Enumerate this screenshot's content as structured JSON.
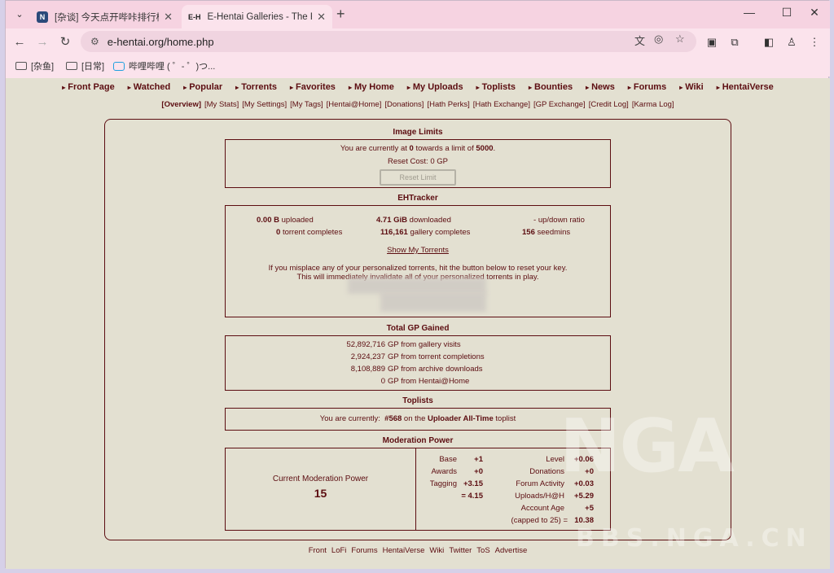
{
  "browser": {
    "tabs": [
      {
        "title": "[杂谈] 今天点开哔咔排行榜一",
        "active": false
      },
      {
        "title": "E-Hentai Galleries - The Free",
        "active": true
      }
    ],
    "inactive_favicon": "N",
    "active_favicon": "E-H",
    "url": "e-hentai.org/home.php",
    "bookmarks": [
      "[杂鱼]",
      "[日常]",
      "哔哩哔哩 ( ゜- ゜)つ..."
    ]
  },
  "nav": {
    "main": [
      "Front Page",
      "Watched",
      "Popular",
      "Torrents",
      "Favorites",
      "My Home",
      "My Uploads",
      "Toplists",
      "Bounties",
      "News",
      "Forums",
      "Wiki",
      "HentaiVerse"
    ],
    "sub": [
      "[Overview]",
      "[My Stats]",
      "[My Settings]",
      "[My Tags]",
      "[Hentai@Home]",
      "[Donations]",
      "[Hath Perks]",
      "[Hath Exchange]",
      "[GP Exchange]",
      "[Credit Log]",
      "[Karma Log]"
    ]
  },
  "image_limits": {
    "title": "Image Limits",
    "text_pre": "You are currently at ",
    "current": "0",
    "text_mid": " towards a limit of ",
    "limit": "5000",
    "text_post": ".",
    "reset_cost_label": "Reset Cost: ",
    "reset_cost_value": "0 GP",
    "reset_button": "Reset Limit"
  },
  "ehtracker": {
    "title": "EHTracker",
    "uploaded_value": "0.00 B",
    "uploaded_label": "uploaded",
    "downloaded_value": "4.71 GiB",
    "downloaded_label": "downloaded",
    "ratio_value": "-",
    "ratio_label": "up/down ratio",
    "torrent_completes_value": "0",
    "torrent_completes_label": "torrent completes",
    "gallery_completes_value": "116,161",
    "gallery_completes_label": "gallery completes",
    "seedmins_value": "156",
    "seedmins_label": "seedmins",
    "show_torrents": "Show My Torrents",
    "info_line1": "If you misplace any of your personalized torrents, hit the button below to reset your key.",
    "info_line2": "This will immediately invalidate all of your personalized torrents in play."
  },
  "gp_gained": {
    "title": "Total GP Gained",
    "rows": [
      {
        "value": "52,892,716",
        "label": "GP from gallery visits"
      },
      {
        "value": "2,924,237",
        "label": "GP from torrent completions"
      },
      {
        "value": "8,108,889",
        "label": "GP from archive downloads"
      },
      {
        "value": "0",
        "label": "GP from Hentai@Home"
      }
    ]
  },
  "toplists": {
    "title": "Toplists",
    "text_pre": "You are currently:",
    "rank": "#568",
    "text_mid": " on the ",
    "list_name": "Uploader All-Time",
    "text_post": " toplist"
  },
  "moderation": {
    "title": "Moderation Power",
    "current_label": "Current Moderation Power",
    "current_value": "15",
    "left_rows": [
      {
        "label": "Base",
        "value": "+1"
      },
      {
        "label": "Awards",
        "value": "+0"
      },
      {
        "label": "Tagging",
        "value": "+3.15"
      },
      {
        "label": "",
        "value": "= 4.15"
      }
    ],
    "right_rows": [
      {
        "label": "Level",
        "value": "+0.06"
      },
      {
        "label": "Donations",
        "value": "+0"
      },
      {
        "label": "Forum Activity",
        "value": "+0.03"
      },
      {
        "label": "Uploads/H@H",
        "value": "+5.29"
      },
      {
        "label": "Account Age",
        "value": "+5"
      },
      {
        "label": "(capped to 25) =",
        "value": "10.38"
      }
    ]
  },
  "footer": [
    "Front",
    "LoFi",
    "Forums",
    "HentaiVerse",
    "Wiki",
    "Twitter",
    "ToS",
    "Advertise"
  ],
  "watermark": {
    "logo": "NGA",
    "url": "BBS.NGA.CN"
  },
  "colors": {
    "page_bg": "#e3e0d1",
    "text": "#5c0d11",
    "browser_frame": "#fbe3ec"
  }
}
